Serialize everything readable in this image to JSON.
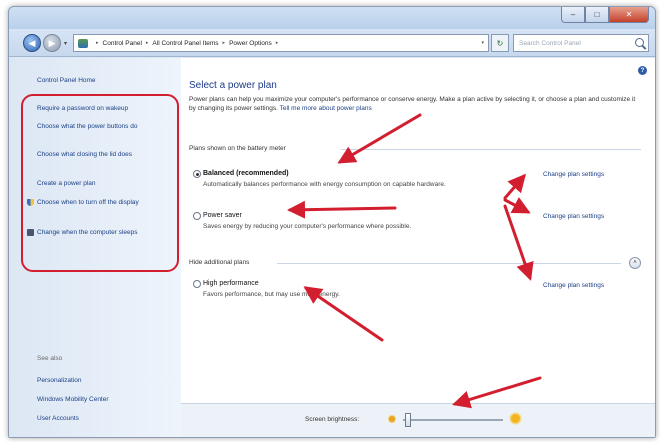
{
  "window": {
    "caption": {
      "minimize": "–",
      "maximize": "□",
      "close": "✕"
    }
  },
  "address": {
    "crumbs": [
      "Control Panel",
      "All Control Panel Items",
      "Power Options"
    ],
    "separator": "▸",
    "search_placeholder": "Search Control Panel"
  },
  "sidebar": {
    "home": "Control Panel Home",
    "tasks": [
      {
        "label": "Require a password on wakeup",
        "icon": ""
      },
      {
        "label": "Choose what the power buttons do",
        "icon": ""
      },
      {
        "label": "Choose what closing the lid does",
        "icon": ""
      },
      {
        "label": "Create a power plan",
        "icon": ""
      },
      {
        "label": "Choose when to turn off the display",
        "icon": "shield-icon"
      },
      {
        "label": "Change when the computer sleeps",
        "icon": "computer-icon"
      }
    ],
    "see_also": {
      "title": "See also",
      "items": [
        "Personalization",
        "Windows Mobility Center",
        "User Accounts"
      ]
    }
  },
  "main": {
    "title": "Select a power plan",
    "intro": "Power plans can help you maximize your computer's performance or conserve energy. Make a plan active by selecting it, or choose a plan and customize it by changing its power settings.",
    "intro_link": "Tell me more about power plans",
    "section_battery": "Plans shown on the battery meter",
    "section_additional": "Hide additional plans",
    "plans": [
      {
        "name": "Balanced (recommended)",
        "desc": "Automatically balances performance with energy consumption on capable hardware.",
        "selected": true
      },
      {
        "name": "Power saver",
        "desc": "Saves energy by reducing your computer's performance where possible.",
        "selected": false
      },
      {
        "name": "High performance",
        "desc": "Favors performance, but may use more energy.",
        "selected": false
      }
    ],
    "change_settings": "Change plan settings"
  },
  "brightness": {
    "label": "Screen brightness:",
    "level": 0.05
  },
  "colors": {
    "annotation_red": "#d21e2e",
    "link_blue": "#1b3f86",
    "title_blue": "#1e3a8a"
  }
}
